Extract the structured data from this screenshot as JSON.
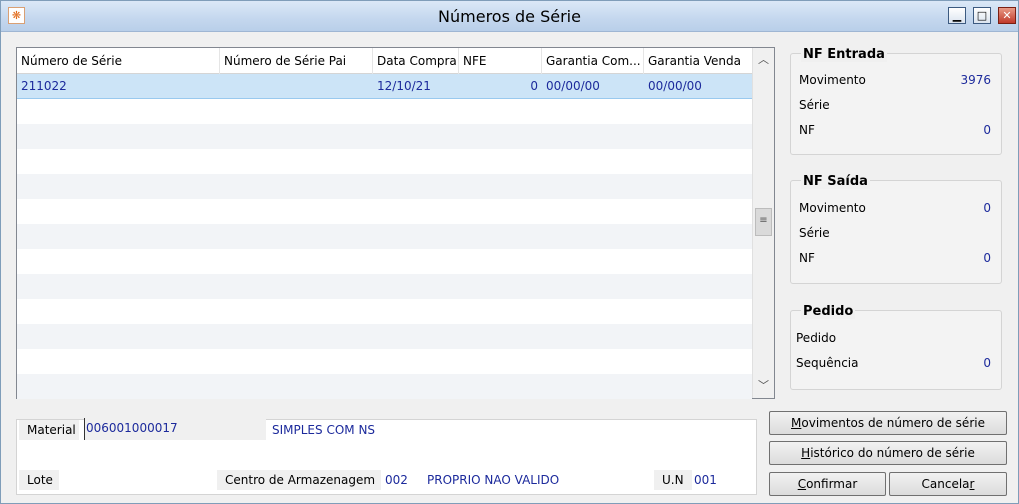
{
  "window": {
    "title": "Números de Série",
    "min_symbol": "▁",
    "max_symbol": "□",
    "close_symbol": "✕"
  },
  "grid": {
    "columns": [
      "Número de Série",
      "Número de Série Pai",
      "Data Compra",
      "NFE",
      "Garantia Com...",
      "Garantia Venda"
    ],
    "rows": [
      {
        "numero_serie": "211022",
        "numero_serie_pai": "",
        "data_compra": "12/10/21",
        "nfe": "0",
        "garantia_compra": "00/00/00",
        "garantia_venda": "00/00/00",
        "selected": true
      }
    ],
    "empty_rows": 12
  },
  "nf_entrada": {
    "title": "NF Entrada",
    "movimento_label": "Movimento",
    "movimento_value": "3976",
    "serie_label": "Série",
    "serie_value": "",
    "nf_label": "NF",
    "nf_value": "0"
  },
  "nf_saida": {
    "title": "NF Saída",
    "movimento_label": "Movimento",
    "movimento_value": "0",
    "serie_label": "Série",
    "serie_value": "",
    "nf_label": "NF",
    "nf_value": "0"
  },
  "pedido": {
    "title": "Pedido",
    "pedido_label": "Pedido",
    "pedido_value": "",
    "sequencia_label": "Sequência",
    "sequencia_value": "0"
  },
  "bottom": {
    "material_label": "Material",
    "material_code": "006001000017",
    "material_desc": "SIMPLES COM NS",
    "lote_label": "Lote",
    "lote_value": "",
    "centro_label": "Centro de Armazenagem",
    "centro_code": "002",
    "centro_desc": "PROPRIO NAO VALIDO",
    "un_label": "U.N",
    "un_value": "001"
  },
  "buttons": {
    "movimentos_prefix": "M",
    "movimentos_rest": "ovimentos de número de série",
    "historico_prefix": "H",
    "historico_rest": "istórico do número de série",
    "confirmar_prefix": "C",
    "confirmar_rest": "onfirmar",
    "cancelar_main": "Cancela",
    "cancelar_underlined": "r"
  },
  "colors": {
    "value_text": "#1c2a9c",
    "selected_row": "#cce4f7"
  }
}
